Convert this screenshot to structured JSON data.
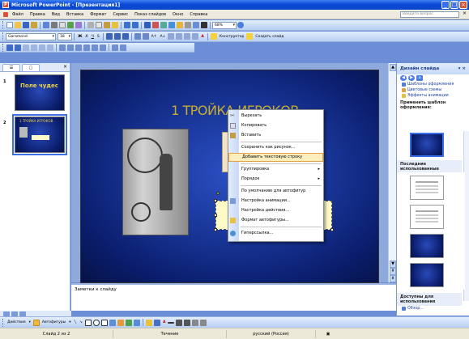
{
  "titlebar": {
    "title": "Microsoft PowerPoint - [Презентация1]",
    "app_icon": "powerpoint-icon"
  },
  "menubar": {
    "items": [
      "Файл",
      "Правка",
      "Вид",
      "Вставка",
      "Формат",
      "Сервис",
      "Показ слайдов",
      "Окно",
      "Справка"
    ],
    "help_placeholder": "Введите вопрос"
  },
  "toolbar_standard": {
    "zoom": "68%"
  },
  "toolbar_format": {
    "font": "Garamond",
    "size": "18",
    "design_label": "Конструктор",
    "new_slide_label": "Создать слайд"
  },
  "slides_panel": {
    "tabs": [
      "☰",
      "▢"
    ],
    "slides": [
      {
        "number": "1",
        "title": "Поле чудес"
      },
      {
        "number": "2",
        "title": "1 ТРОЙКА ИГРОКОВ"
      }
    ]
  },
  "slide": {
    "title": "1 ТРОЙКА ИГРОКОВ"
  },
  "notes": {
    "placeholder": "Заметки к слайду"
  },
  "context_menu": {
    "items": [
      {
        "label": "Вырезать",
        "icon": "scissors-icon",
        "submenu": false
      },
      {
        "label": "Копировать",
        "icon": "copy-icon",
        "submenu": false
      },
      {
        "label": "Вставить",
        "icon": "paste-icon",
        "submenu": false
      },
      {
        "label": "Сохранить как рисунок...",
        "icon": "",
        "submenu": false
      },
      {
        "label": "Добавить текстовую строку",
        "icon": "",
        "submenu": false,
        "highlighted": true
      },
      {
        "label": "Группировка",
        "icon": "",
        "submenu": true
      },
      {
        "label": "Порядок",
        "icon": "",
        "submenu": true
      },
      {
        "label": "По умолчанию для автофигур",
        "icon": "",
        "submenu": false
      },
      {
        "label": "Настройка анимации...",
        "icon": "animation-icon",
        "submenu": false
      },
      {
        "label": "Настройка действия...",
        "icon": "",
        "submenu": false
      },
      {
        "label": "Формат автофигуры...",
        "icon": "format-shape-icon",
        "submenu": false
      },
      {
        "label": "Гиперссылка...",
        "icon": "hyperlink-icon",
        "submenu": false
      }
    ]
  },
  "task_pane": {
    "title": "Дизайн слайда",
    "links": [
      "Шаблоны оформления",
      "Цветовые схемы",
      "Эффекты анимации"
    ],
    "apply_label": "Применить шаблон оформления:",
    "recent_label": "Последние использованные",
    "available_label": "Доступны для использования",
    "browse_label": "Обзор..."
  },
  "draw_toolbar": {
    "actions_label": "Действия",
    "autoshapes_label": "Автофигуры"
  },
  "statusbar": {
    "slide": "Слайд 2 из 2",
    "design": "Течение",
    "language": "русский (Россия)"
  },
  "colors": {
    "accent": "#0a49d6",
    "slide_bg": "#173494",
    "title_gold": "#c8ad2e",
    "menu_highlight": "#ffeebd"
  }
}
